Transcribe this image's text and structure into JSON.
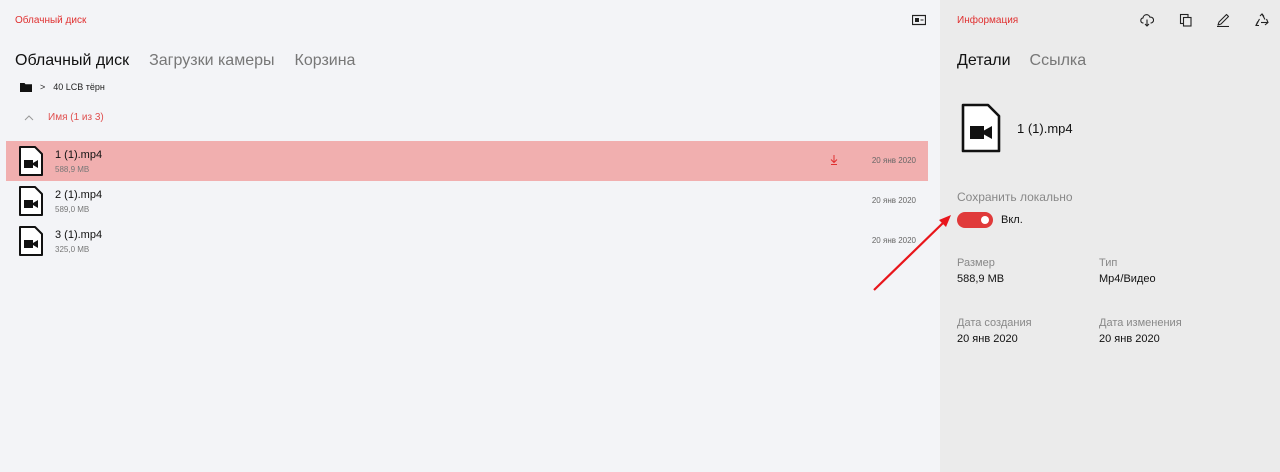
{
  "app": {
    "title": "Облачный диск"
  },
  "tabs": [
    {
      "label": "Облачный диск",
      "active": true
    },
    {
      "label": "Загрузки камеры",
      "active": false
    },
    {
      "label": "Корзина",
      "active": false
    }
  ],
  "breadcrumb": {
    "separator": ">",
    "folder": "40 LCB тёрн"
  },
  "sort": {
    "label": "Имя (1 из 3)"
  },
  "files": [
    {
      "name": "1 (1).mp4",
      "size": "588,9 MB",
      "date": "20 янв 2020",
      "selected": true,
      "downloading": true
    },
    {
      "name": "2 (1).mp4",
      "size": "589,0 MB",
      "date": "20 янв 2020",
      "selected": false,
      "downloading": false
    },
    {
      "name": "3 (1).mp4",
      "size": "325,0 MB",
      "date": "20 янв 2020",
      "selected": false,
      "downloading": false
    }
  ],
  "info": {
    "title": "Информация",
    "tabs": [
      {
        "label": "Детали",
        "active": true
      },
      {
        "label": "Ссылка",
        "active": false
      }
    ],
    "file_name": "1 (1).mp4",
    "save_local_label": "Сохранить локально",
    "toggle_state": "Вкл.",
    "size_label": "Размер",
    "size_value": "588,9 MB",
    "type_label": "Тип",
    "type_value": "Mp4/Видео",
    "created_label": "Дата создания",
    "created_value": "20 янв 2020",
    "modified_label": "Дата изменения",
    "modified_value": "20 янв 2020"
  },
  "icons": {
    "view_toggle": "view-toggle-icon",
    "folder": "folder-icon",
    "sort": "chevron-up-icon",
    "file": "video-file-icon",
    "download": "download-arrow-icon",
    "cloud_download": "cloud-download-icon",
    "copy": "copy-icon",
    "rename": "pencil-icon",
    "recycle": "recycle-icon"
  },
  "colors": {
    "accent": "#e03030",
    "selected_row": "#f1afaf",
    "toggle_on": "#e03a3a",
    "annotation_arrow": "#e8151b"
  }
}
